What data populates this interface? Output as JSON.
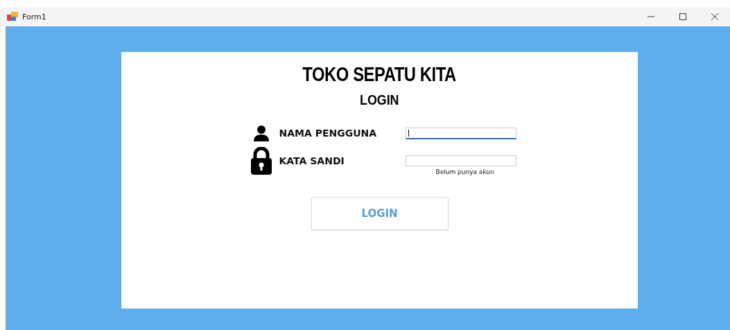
{
  "window": {
    "title": "Form1"
  },
  "form": {
    "title": "TOKO SEPATU KITA",
    "subtitle": "LOGIN",
    "fields": [
      {
        "kind": "user",
        "label": "NAMA PENGGUNA",
        "focused": true
      },
      {
        "kind": "lock",
        "label": "KATA SANDI",
        "focused": false
      }
    ],
    "register_link": "Belum punya akun",
    "login_button": "LOGIN"
  }
}
